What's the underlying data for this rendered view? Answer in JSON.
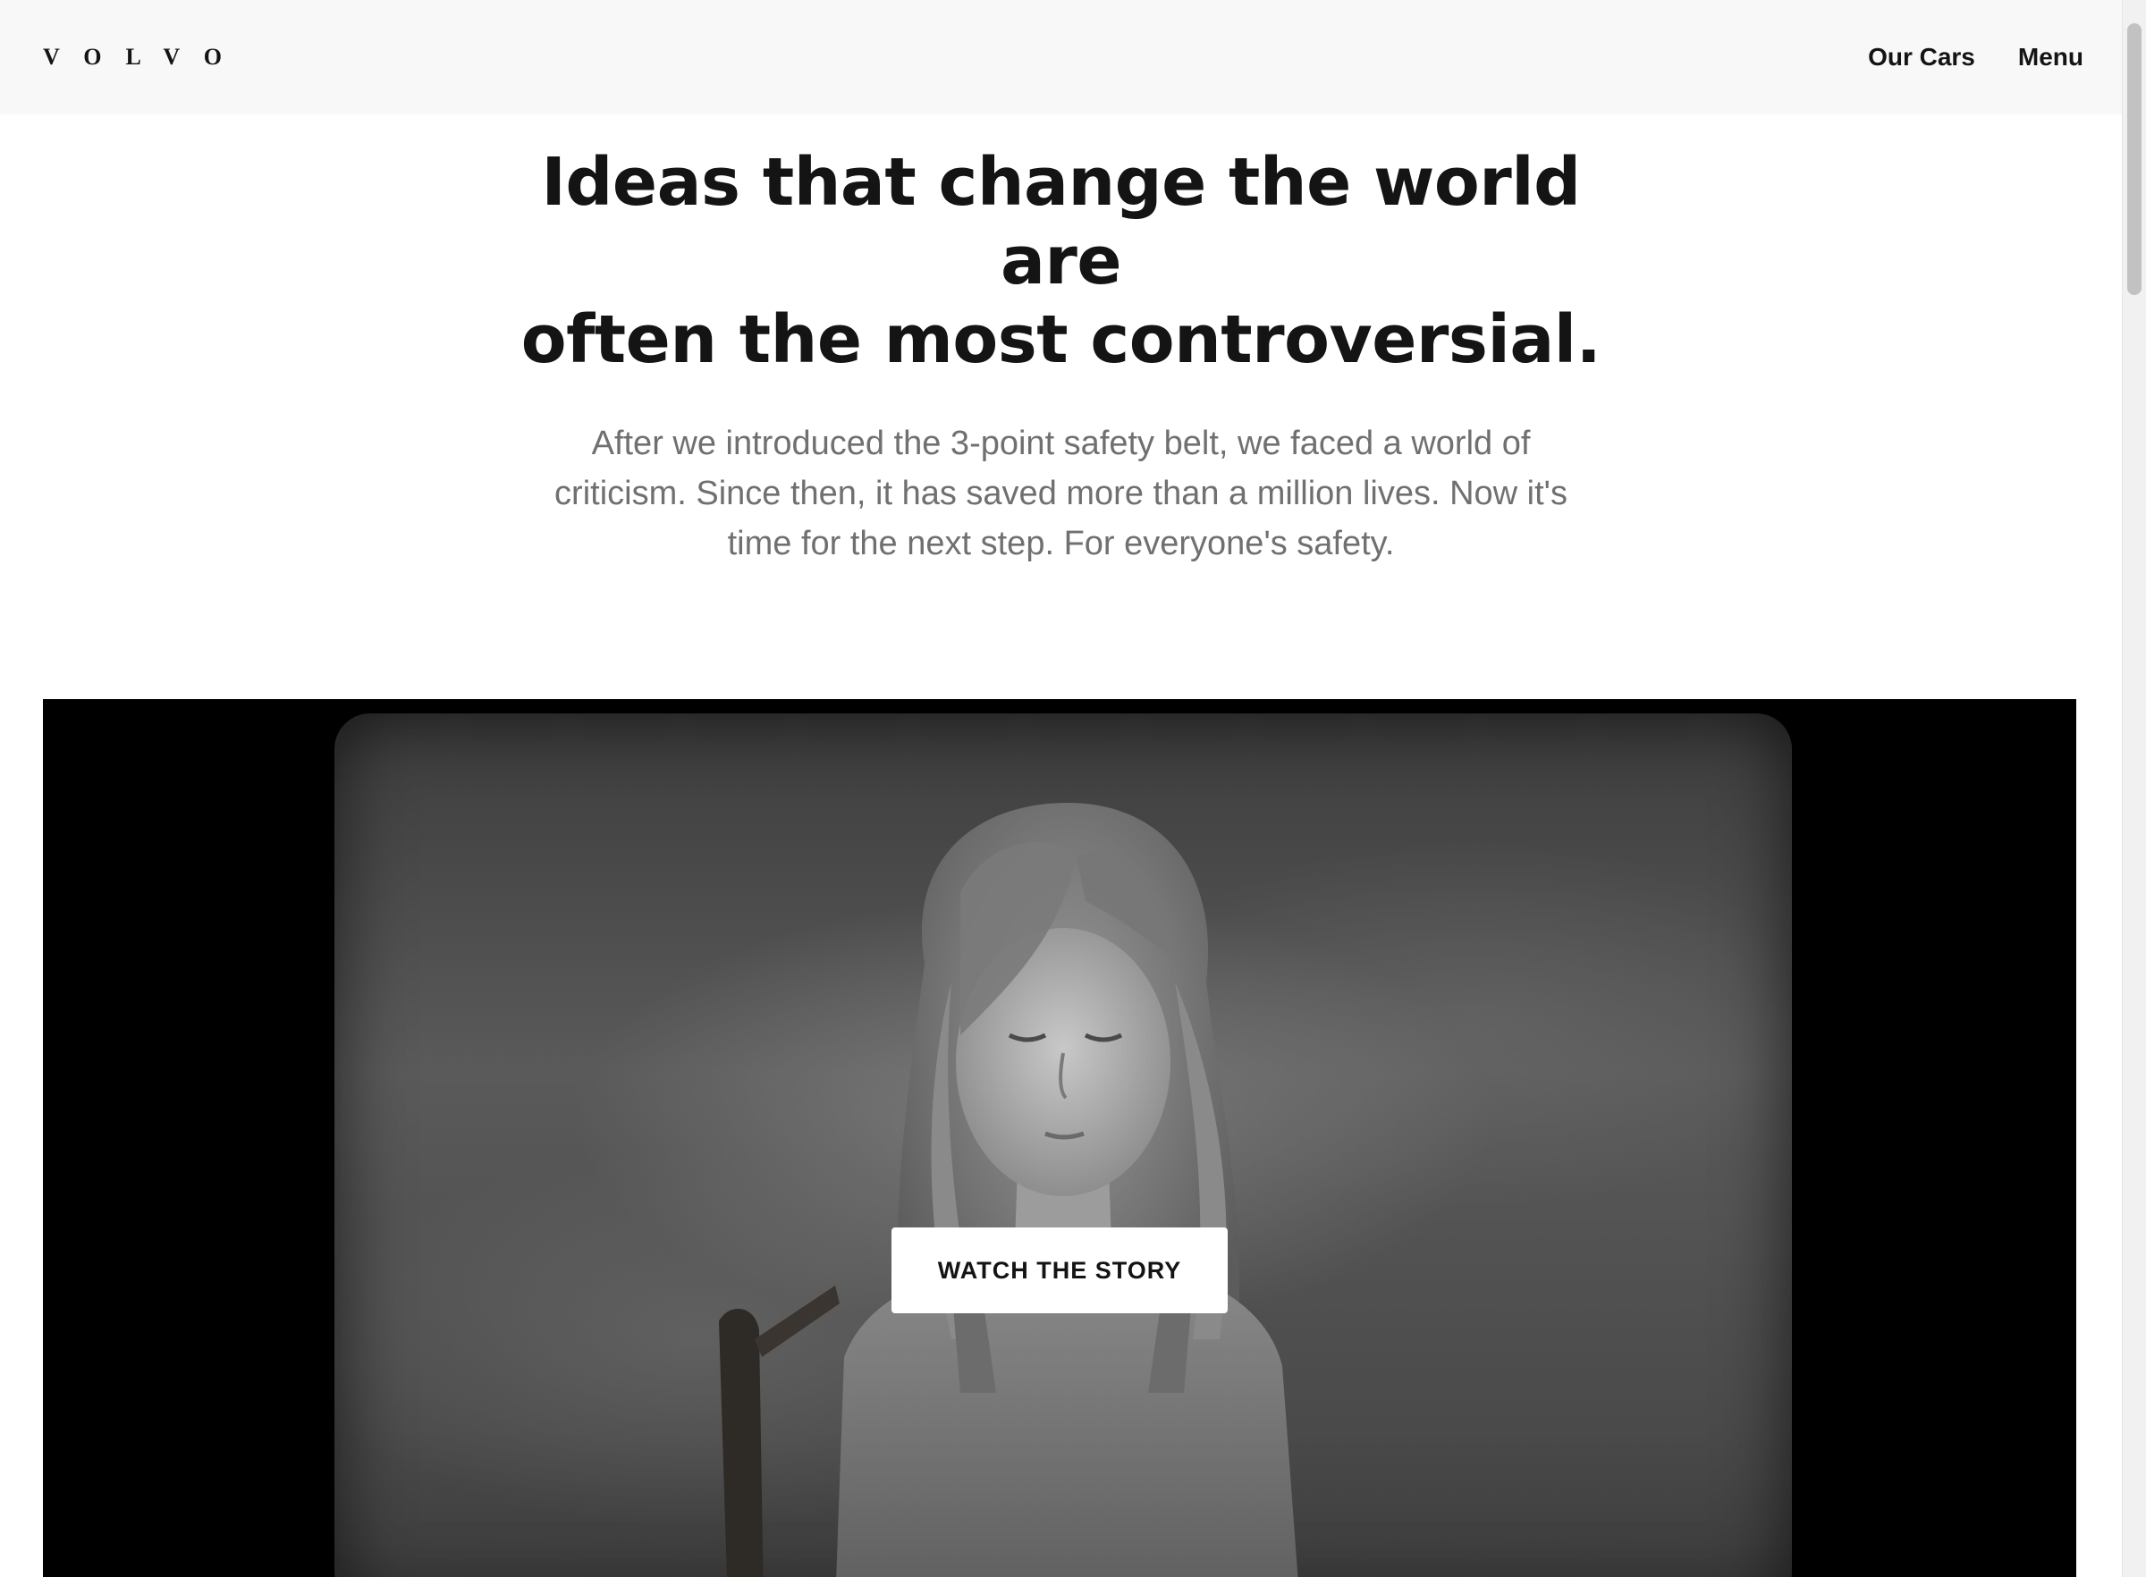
{
  "header": {
    "logo_text": "VOLVO",
    "nav": [
      {
        "label": "Our Cars"
      },
      {
        "label": "Menu"
      }
    ]
  },
  "intro": {
    "headline_line1": "Ideas that change the world are",
    "headline_line2": "often the most controversial.",
    "lead_line1": "After we introduced the 3-point safety belt, we faced a world of",
    "lead_line2": "criticism. Since then, it has saved more than a million lives. Now it's",
    "lead_line3": "time for the next step. For everyone's safety."
  },
  "video": {
    "cta_label": "WATCH THE STORY"
  },
  "colors": {
    "header_bg": "#f8f8f8",
    "text_primary": "#141414",
    "text_secondary": "#707070",
    "video_bg": "#000000",
    "button_bg": "#ffffff"
  }
}
